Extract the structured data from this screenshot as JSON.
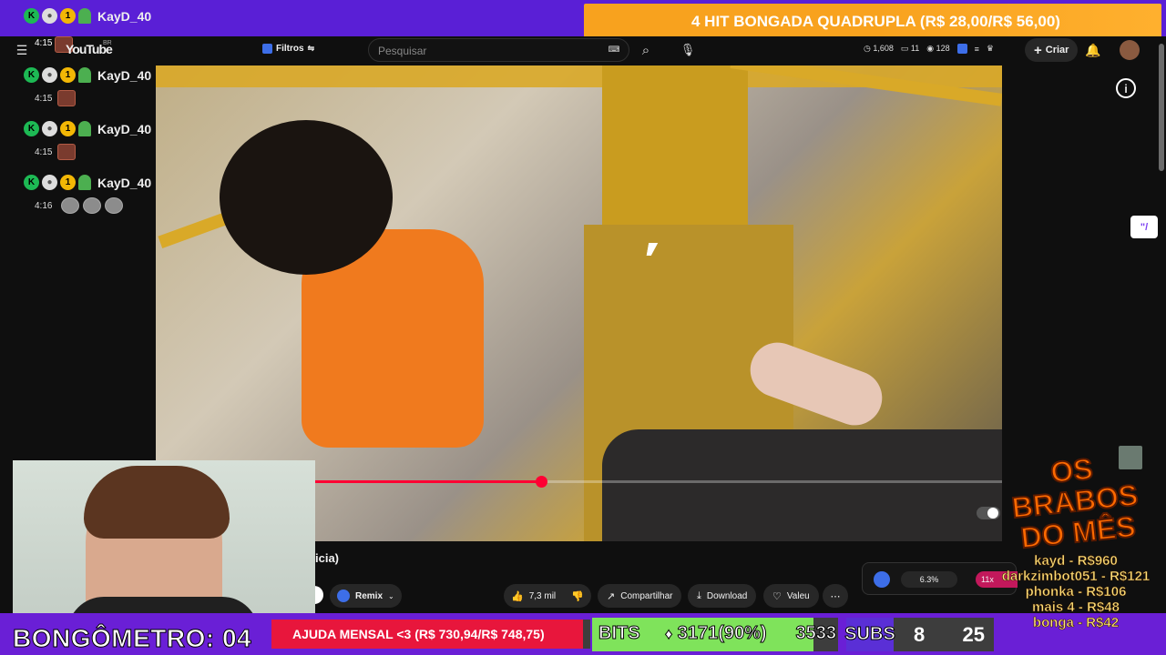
{
  "alert": {
    "text": "4 HIT BONGADA QUADRUPLA (R$ 28,00/R$ 56,00)"
  },
  "chat": {
    "username": "KayD_40",
    "entries": [
      {
        "time": "4:15"
      },
      {
        "time": "4:15"
      },
      {
        "time": "4:15"
      },
      {
        "time": "4:16"
      }
    ]
  },
  "youtube": {
    "logo": "YouTube",
    "region": "BR",
    "filters_label": "Filtros",
    "search_placeholder": "Pesquisar",
    "stats": {
      "views": "1,608",
      "comments": "11",
      "watching": "128"
    },
    "create_label": "Criar"
  },
  "video": {
    "title_fragment": "icia)",
    "progress": 0.33,
    "likes": "7,3 mil",
    "share_label": "Compartilhar",
    "download_label": "Download",
    "valeu_label": "Valeu",
    "remix_label": "Remix",
    "percent": "6.3%",
    "multiplier": "11x"
  },
  "overlay": {
    "bongometro": "BONGÔMETRO: 04",
    "ajuda": "AJUDA MENSAL <3 (R$ 730,94/R$ 748,75)",
    "ajuda_progress": 0.976,
    "bits_label": "BITS",
    "bits_value": "3171(90%)",
    "bits_goal": "3533",
    "bits_progress": 0.9,
    "subs_label": "SUBS",
    "subs_current": "8",
    "subs_goal": "25",
    "brabos_title_1": "OS",
    "brabos_title_2": "BRABOS",
    "brabos_title_3": "DO MÊS",
    "brabos": [
      "kayd - R$960",
      "darkzimbot051 - R$121",
      "phonka - R$106",
      "mais 4 - R$48",
      "bonga - R$42"
    ]
  },
  "colors": {
    "twitch_purple": "#6a1fd6",
    "alert_orange": "#f8a21e",
    "yt_red": "#ff0033",
    "bits_green": "#7fe35b",
    "ajuda_red": "#e8163c"
  }
}
